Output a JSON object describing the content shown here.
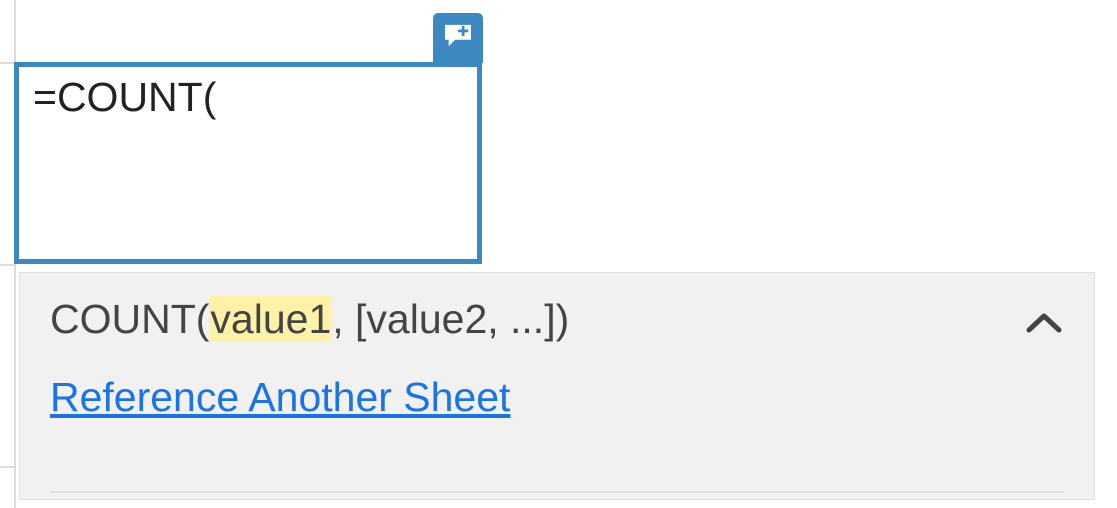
{
  "cell": {
    "formula_text": "=COUNT("
  },
  "tooltip": {
    "fn_name": "COUNT",
    "open_paren": "(",
    "arg_current": "value1",
    "args_rest": ", [value2, ...])",
    "reference_link_label": "Reference Another Sheet"
  },
  "icons": {
    "comment": "comment-plus-icon",
    "chevron": "chevron-up-icon"
  },
  "colors": {
    "accent": "#3e88c1",
    "link": "#1a73e8",
    "highlight": "#fff2a8",
    "panel_bg": "#f1f1f1"
  }
}
